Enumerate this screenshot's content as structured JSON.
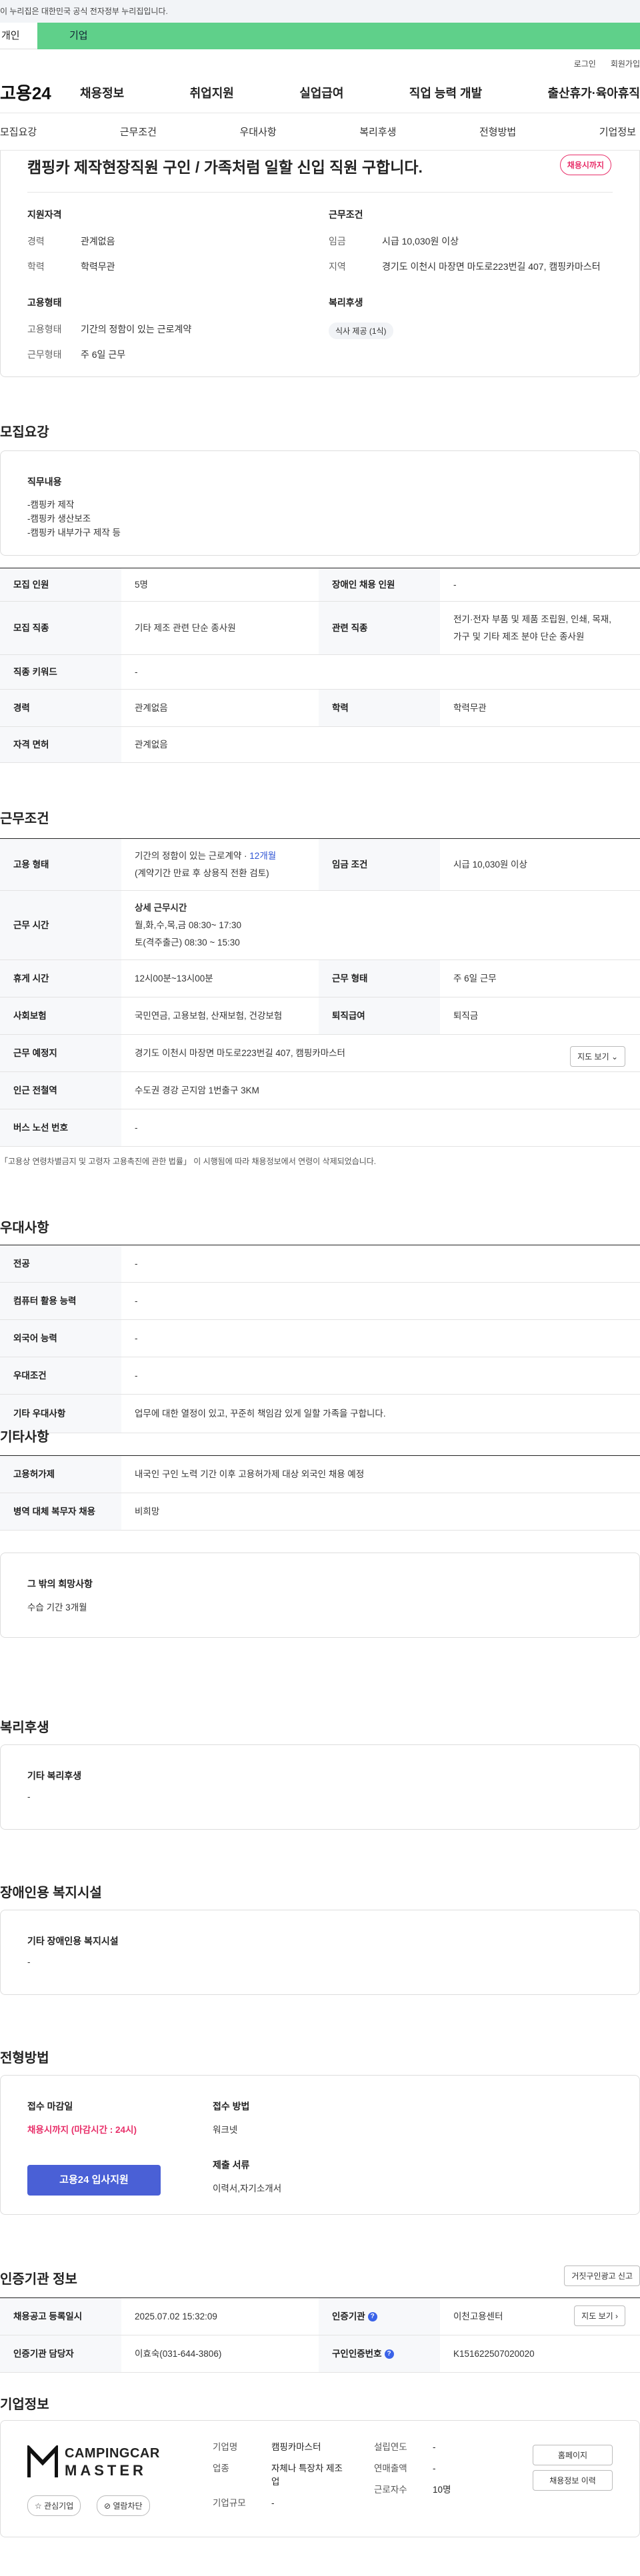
{
  "gov_banner": "이 누리집은 대한민국 공식 전자정부 누리집입니다.",
  "top_tabs": [
    "개인",
    "기업"
  ],
  "util": [
    "로그인",
    "회원가입"
  ],
  "gnb": {
    "logo": "고용24",
    "menu": [
      "채용정보",
      "취업지원",
      "실업급여",
      "직업 능력 개발",
      "출산휴가·육아휴직"
    ]
  },
  "subtabs": [
    "모집요강",
    "근무조건",
    "우대사항",
    "복리후생",
    "전형방법",
    "기업정보"
  ],
  "header": {
    "title": "캠핑카 제작현장직원 구인 / 가족처럼 일할 신입 직원 구합니다.",
    "deadline": "채용시까지",
    "qual_title": "지원자격",
    "qual": [
      {
        "k": "경력",
        "v": "관계없음"
      },
      {
        "k": "학력",
        "v": "학력무관"
      }
    ],
    "cond_title": "근무조건",
    "cond": [
      {
        "k": "임금",
        "v": "시급 10,030원 이상"
      },
      {
        "k": "지역",
        "v": "경기도 이천시 마장면 마도로223번길 407, 캠핑카마스터"
      }
    ],
    "emp_title": "고용형태",
    "emp": [
      {
        "k": "고용형태",
        "v": "기간의 정함이 있는 근로계약"
      },
      {
        "k": "근무형태",
        "v": "주 6일 근무"
      }
    ],
    "welfare_title": "복리후생",
    "welfare_pill": "식사 제공 (1식)"
  },
  "recruit": {
    "title": "모집요강",
    "duty_title": "직무내용",
    "duty_lines": [
      "-캠핑카 제작",
      "-캠핑카 생산보조",
      "-캠핑카 내부가구 제작 등"
    ],
    "rows": {
      "count_k": "모집 인원",
      "count_v": "5명",
      "disabled_k": "장애인 채용 인원",
      "disabled_v": "-",
      "job_k": "모집 직종",
      "job_v": "기타 제조 관련 단순 종사원",
      "rel_k": "관련 직종",
      "rel_v1": "전기·전자 부품 및 제품 조립원, 인쇄, 목재,",
      "rel_v2": "가구 및 기타 제조 분야 단순 종사원",
      "kw_k": "직종 키워드",
      "kw_v": "-",
      "career_k": "경력",
      "career_v": "관계없음",
      "edu_k": "학력",
      "edu_v": "학력무관",
      "license_k": "자격 면허",
      "license_v": "관계없음"
    }
  },
  "work": {
    "title": "근무조건",
    "type_k": "고용 형태",
    "type_v1": "기간의 정함이 있는 근로계약 · ",
    "type_v1_period": "12개월",
    "type_v2": "(계약기간 만료 후 상용직 전환 검토)",
    "wage_k": "임금 조건",
    "wage_v": "시급 10,030원 이상",
    "hours_k": "근무 시간",
    "hours_title": "상세 근무시간",
    "hours_v1": "월,화,수,목,금 08:30~ 17:30",
    "hours_v2": "토(격주출근) 08:30 ~ 15:30",
    "break_k": "휴게 시간",
    "break_v": "12시00분~13시00분",
    "form_k": "근무 형태",
    "form_v": "주 6일 근무",
    "ins_k": "사회보험",
    "ins_v": "국민연금, 고용보험, 산재보험, 건강보험",
    "ret_k": "퇴직급여",
    "ret_v": "퇴직금",
    "place_k": "근무 예정지",
    "place_v": "경기도 이천시 마장면 마도로223번길 407, 캠핑카마스터",
    "map_btn": "지도 보기 ⌄",
    "subway_k": "인근 전철역",
    "subway_v": "수도권 경강 곤지암 1번출구 3KM",
    "bus_k": "버스 노선 번호",
    "bus_v": "-",
    "note": "「고용상 연령차별금지 및 고령자 고용촉진에 관한 법률」 이 시행됨에 따라 채용정보에서 연령이 삭제되었습니다."
  },
  "pref": {
    "title": "우대사항",
    "rows": [
      {
        "k": "전공",
        "v": "-"
      },
      {
        "k": "컴퓨터 활용 능력",
        "v": "-"
      },
      {
        "k": "외국어 능력",
        "v": "-"
      },
      {
        "k": "우대조건",
        "v": "-"
      },
      {
        "k": "기타 우대사항",
        "v": "업무에 대한 열정이 있고, 꾸준히 책임감 있게 일할 가족을 구합니다."
      }
    ]
  },
  "etc": {
    "title": "기타사항",
    "rows": [
      {
        "k": "고용허가제",
        "v": "내국인 구인 노력 기간 이후 고용허가제 대상 외국인 채용 예정"
      },
      {
        "k": "병역 대체 복무자 채용",
        "v": "비희망"
      }
    ],
    "wish_title": "그 밖의 희망사항",
    "wish_v": "수습 기간 3개월"
  },
  "benefit": {
    "title": "복리후생",
    "sub": "기타 복리후생",
    "v": "-"
  },
  "disabled": {
    "title": "장애인용 복지시설",
    "sub": "기타 장애인용 복지시설",
    "v": "-"
  },
  "selection": {
    "title": "전형방법",
    "deadline_title": "접수 마감일",
    "deadline_v": "채용시까지 (마감시간 : 24시)",
    "apply_btn": "고용24 입사지원",
    "method_title": "접수 방법",
    "method_v": "워크넷",
    "docs_title": "제출 서류",
    "docs_v": "이력서,자기소개서"
  },
  "agency": {
    "title": "인증기관 정보",
    "report_btn": "거짓구인광고 신고",
    "reg_k": "채용공고 등록일시",
    "reg_v": "2025.07.02 15:32:09",
    "org_k": "인증기관",
    "org_v": "이천고용센터",
    "map_btn": "지도 보기 ›",
    "mgr_k": "인증기관 담당자",
    "mgr_v": "이효숙(031-644-3806)",
    "no_k": "구인인증번호",
    "no_v": "K151622507020020"
  },
  "company": {
    "title": "기업정보",
    "logo_line1": "CAMPINGCAR",
    "logo_line2": "MASTER",
    "interest_btn": "☆ 관심기업",
    "block_btn": "⊘ 열람차단",
    "name_k": "기업명",
    "name_v": "캠핑카마스터",
    "ind_k": "업종",
    "ind_v": "자체나 특장차 제조업",
    "size_k": "기업규모",
    "size_v": "-",
    "est_k": "설립연도",
    "est_v": "-",
    "sales_k": "연매출액",
    "sales_v": "-",
    "emp_k": "근로자수",
    "emp_v": "10명",
    "home_btn": "홈페이지",
    "history_btn": "채용정보 이력"
  }
}
